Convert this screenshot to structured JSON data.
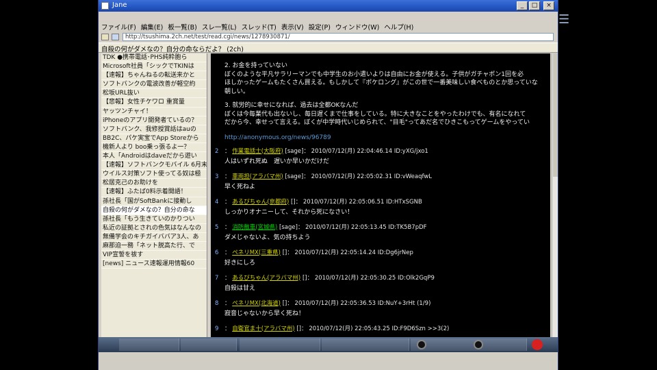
{
  "window": {
    "title": "Jane",
    "buttons": [
      "_",
      "□",
      "×"
    ]
  },
  "menu": [
    "ファイル(F)",
    "編集(E)",
    "板一覧(B)",
    "スレ一覧(L)",
    "スレッド(T)",
    "表示(V)",
    "設定(P)",
    "ウィンドウ(W)",
    "ヘルプ(H)"
  ],
  "address": "http://tsushima.2ch.net/test/read.cgi/news/1278930871/",
  "thread_title": "自殺の何がダメなの？自分の命ならだよ？ (2ch)",
  "thread_list": [
    "TDK ●携帯電話･PHS純粋胞ら",
    "Microsoft社員「シックでTKINは",
    "【速報】ちゃんねるの転送来かと",
    "ソフトバンクの電波改善が軽空約",
    "松坂URL抜い",
    "【悲報】女性チケワロ 重賞量",
    "ヤッツンチャイ！",
    "iPhoneのアプリ開発者ているの？",
    "ソフトバンク、我修授賞話はauの",
    "BB2C、パケ実宝でApp Storeから",
    "機新人より boo乗っ張るよ一？",
    "本人「Androidはdaveだから遊い",
    "【速報】ソフトバンクモバイル 6月末",
    "ウイルス対策ソフト使ってる奴は極",
    "松居克己のお助けを",
    "【速報】ふたば0料示着開語！",
    "孫社長「国がSoftBankに接動し",
    "自殺の何がダメなの？自分の命な",
    "孫社長「もう生きていのかりつい",
    "私近の証拠とされの色気はなんなの",
    "無備学会のキチガイババア3人、あ",
    "麻那迫一務「ネット脱高た行、で",
    "VIP宣誓を祓す",
    "[news] ニュース速報運用情報60"
  ],
  "content": {
    "intro_lines": [
      "2. お金を持っていない",
      "ぼくのような平凡サラリーマンでも中学生のお小遣いよりは自由にお金が使える。子供がガチャポン1回を必",
      "ほしかったゲームもたくさん買える。もしかして『ポケロング』がこの世で一番美味しい食べものとか思っていな",
      "朝しい。",
      "",
      "3. 就労的に幸せになれば、過去は全都OKなんだ",
      "ぼくは今毎業代も出ないし、毎日遅くまで仕事をしている。特に大きなことをやったわけでも、有名になれて",
      "だから今、幸せって言える。ぼくが中学時代いじめられて、\"目毛\"ってあだ名でひきこもってゲームをやってい"
    ],
    "link": "http://anonymous.org/news/96789",
    "posts": [
      {
        "num": "2",
        "name": "作業電話士(大阪府)",
        "mail": "[sage]",
        "date": "2010/07/12(月) 22:04:46.14 ID:yXG/jxo1",
        "text": "人はいずれ死ぬ　遅いか早いかだけだ",
        "green": false
      },
      {
        "num": "3",
        "name": "車両担(アラバマ州)",
        "mail": "[sage]",
        "date": "2010/07/12(月) 22:05:02.31 ID:vWeaqfwL",
        "text": "早く死ねよ",
        "green": false
      },
      {
        "num": "4",
        "name": "あるびちゃん(京都府)",
        "mail": "[]",
        "date": "2010/07/12(月) 22:05:06.51 ID:HTxSGNB",
        "text": "しっかりオナニーして、それから死になさい！",
        "green": false
      },
      {
        "num": "5",
        "name": "消防敵車(宮城県)",
        "mail": "[sage]",
        "date": "2010/07/12(月) 22:05:13.45 ID:TK5B7pDF",
        "text": "ダメじゃないよ、気の持ちよう",
        "green": true
      },
      {
        "num": "6",
        "name": "ペネリMX(三重県)",
        "mail": "[]",
        "date": "2010/07/12(月) 22:05:14.24 ID:Dg6jrNep",
        "text": "好きにしろ",
        "green": false
      },
      {
        "num": "7",
        "name": "あるびちゃん(アラバマ州)",
        "mail": "[]",
        "date": "2010/07/12(月) 22:05:30.25 ID:Olk2GqP9",
        "text": "自殺は甘え",
        "green": false
      },
      {
        "num": "8",
        "name": "ペネリMX(北海道)",
        "mail": "[]",
        "date": "2010/07/12(月) 22:05:36.53 ID:NuY+3rHt (1/9)",
        "text": "寂音じゃないから早く死ね！",
        "green": false
      },
      {
        "num": "9",
        "name": "自衛官ま十(アラバマ州)",
        "mail": "[]",
        "date": "2010/07/12(月) 22:05:43.25 ID:F9D6Szn  >>3(2)",
        "text": "",
        "green": false
      }
    ]
  },
  "taskbar": {
    "items": [
      "",
      "",
      "",
      "",
      ""
    ]
  }
}
